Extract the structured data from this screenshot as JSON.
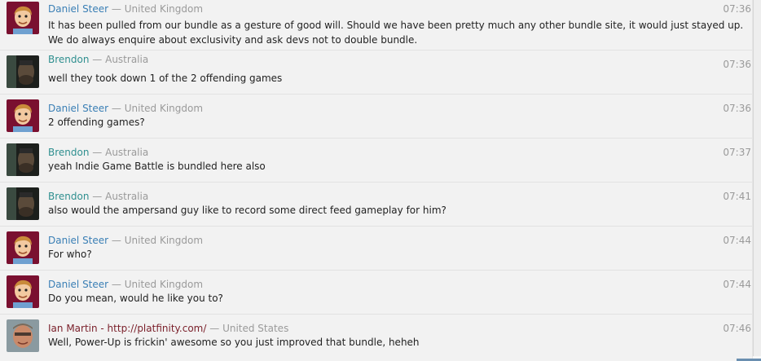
{
  "messages": [
    {
      "name": "Daniel Steer",
      "sep": " — ",
      "country": "United Kingdom",
      "time": "07:36",
      "text": "It has been pulled from our bundle as a gesture of good will. Should we have been pretty much any other bundle site, it would just stayed up. We do always enquire about exclusivity and ask devs not to double bundle.",
      "avatar": "cartoon-face"
    },
    {
      "name": "Brendon",
      "sep": " — ",
      "country": "Australia",
      "time": "07:36",
      "text": "well they took down 1 of the 2 offending games",
      "avatar": "dark-photo"
    },
    {
      "name": "Daniel Steer",
      "sep": " — ",
      "country": "United Kingdom",
      "time": "07:36",
      "text": "2 offending games?",
      "avatar": "cartoon-face"
    },
    {
      "name": "Brendon",
      "sep": " — ",
      "country": "Australia",
      "time": "07:37",
      "text": "yeah Indie Game Battle is bundled here also",
      "avatar": "dark-photo"
    },
    {
      "name": "Brendon",
      "sep": " — ",
      "country": "Australia",
      "time": "07:41",
      "text": "also would the ampersand guy like to record some direct feed gameplay for him?",
      "avatar": "dark-photo"
    },
    {
      "name": "Daniel Steer",
      "sep": " — ",
      "country": "United Kingdom",
      "time": "07:44",
      "text": "For who?",
      "avatar": "cartoon-face"
    },
    {
      "name": "Daniel Steer",
      "sep": " — ",
      "country": "United Kingdom",
      "time": "07:44",
      "text": "Do you mean, would he like you to?",
      "avatar": "cartoon-face"
    },
    {
      "name": "Ian Martin - http://platfinity.com/",
      "sep": " — ",
      "country": "United States",
      "time": "07:46",
      "text": "Well, Power-Up is frickin' awesome so you just improved that bundle, heheh",
      "avatar": "photo-face"
    }
  ],
  "colors": {
    "daniel": "#3a7fb5",
    "brendon": "#2f8f8f",
    "ian": "#7a1f2a",
    "meta": "#9a9a9a"
  }
}
